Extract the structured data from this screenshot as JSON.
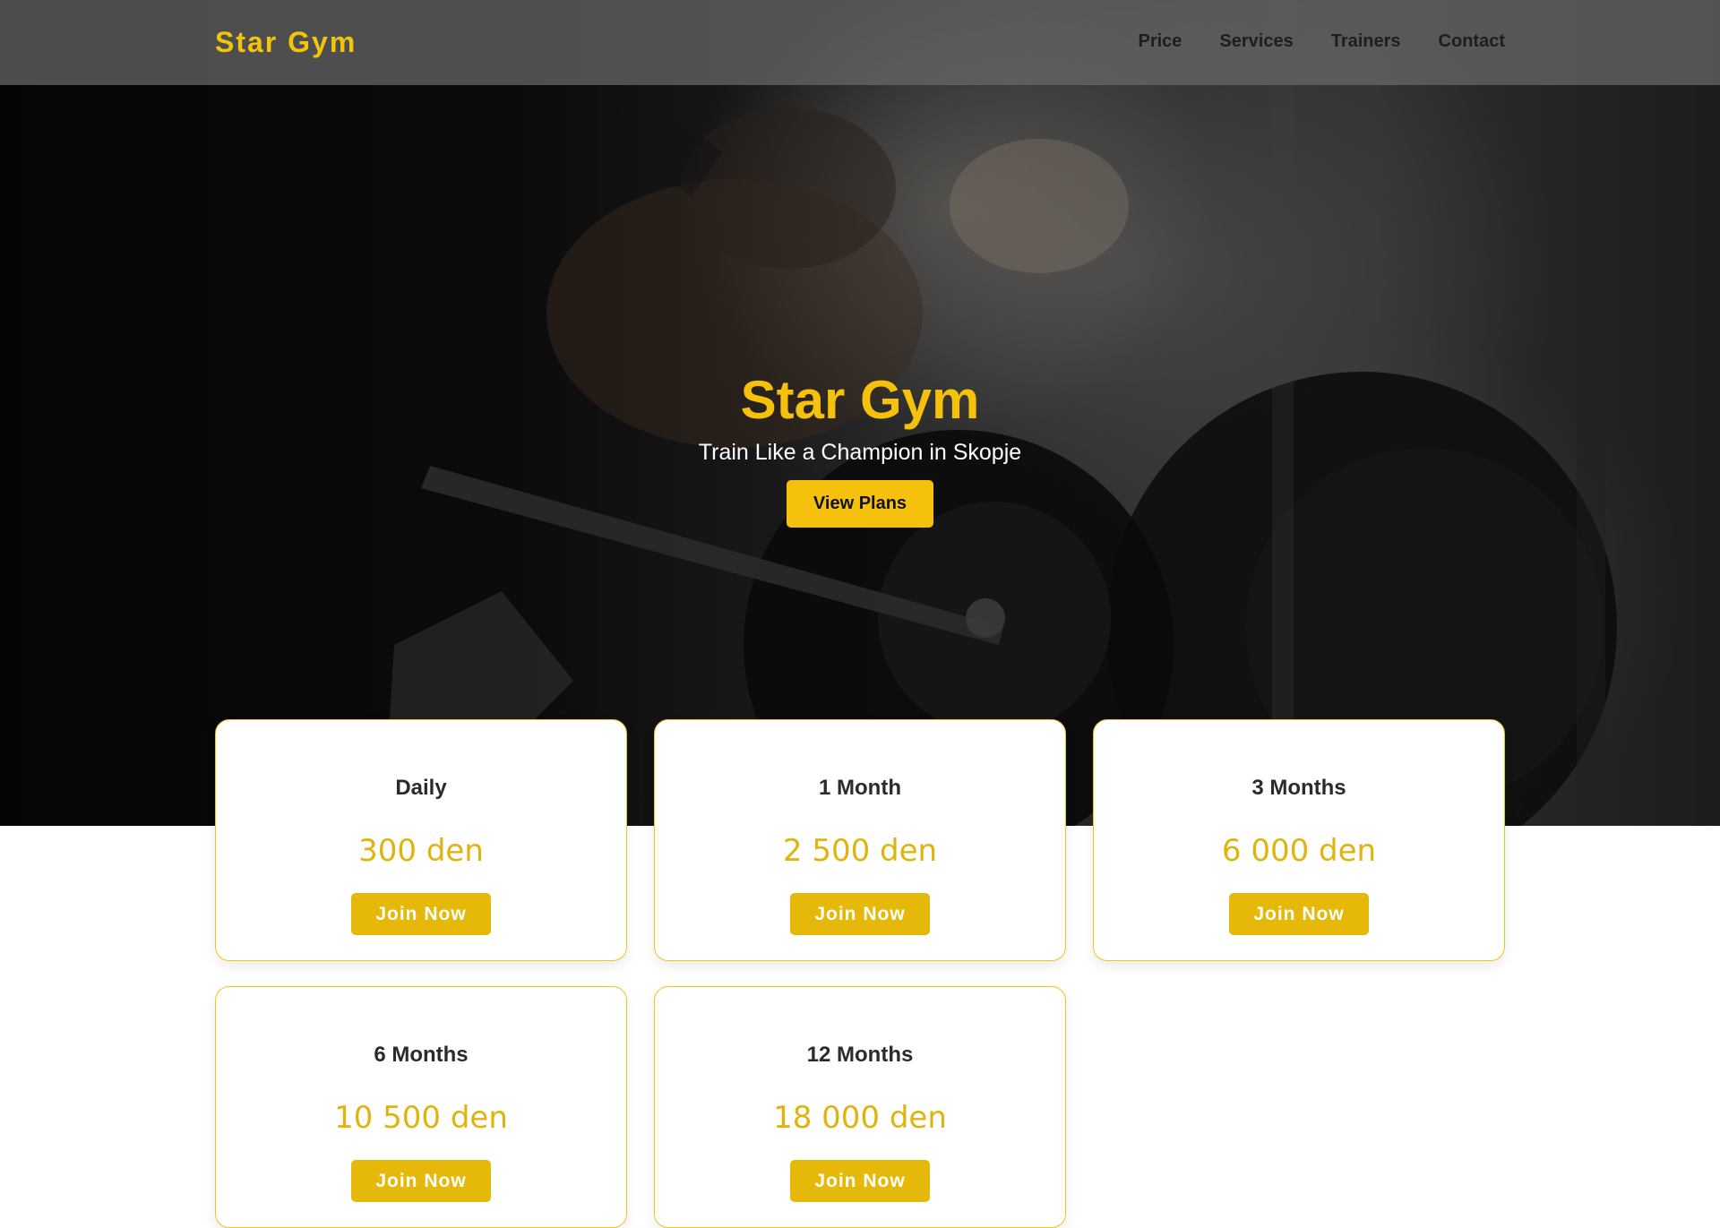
{
  "brand": {
    "logo": "Star Gym",
    "accent_color": "#f5c10d"
  },
  "nav": {
    "items": [
      {
        "label": "Price"
      },
      {
        "label": "Services"
      },
      {
        "label": "Trainers"
      },
      {
        "label": "Contact"
      }
    ]
  },
  "hero": {
    "title": "Star Gym",
    "subtitle": "Train Like a Champion in Skopje",
    "button_label": "View Plans"
  },
  "plans": [
    {
      "name": "Daily",
      "price": "300 den",
      "button_label": "Join Now"
    },
    {
      "name": "1 Month",
      "price": "2 500 den",
      "button_label": "Join Now"
    },
    {
      "name": "3 Months",
      "price": "6 000 den",
      "button_label": "Join Now"
    },
    {
      "name": "6 Months",
      "price": "10 500 den",
      "button_label": "Join Now"
    },
    {
      "name": "12 Months",
      "price": "18 000 den",
      "button_label": "Join Now"
    }
  ]
}
